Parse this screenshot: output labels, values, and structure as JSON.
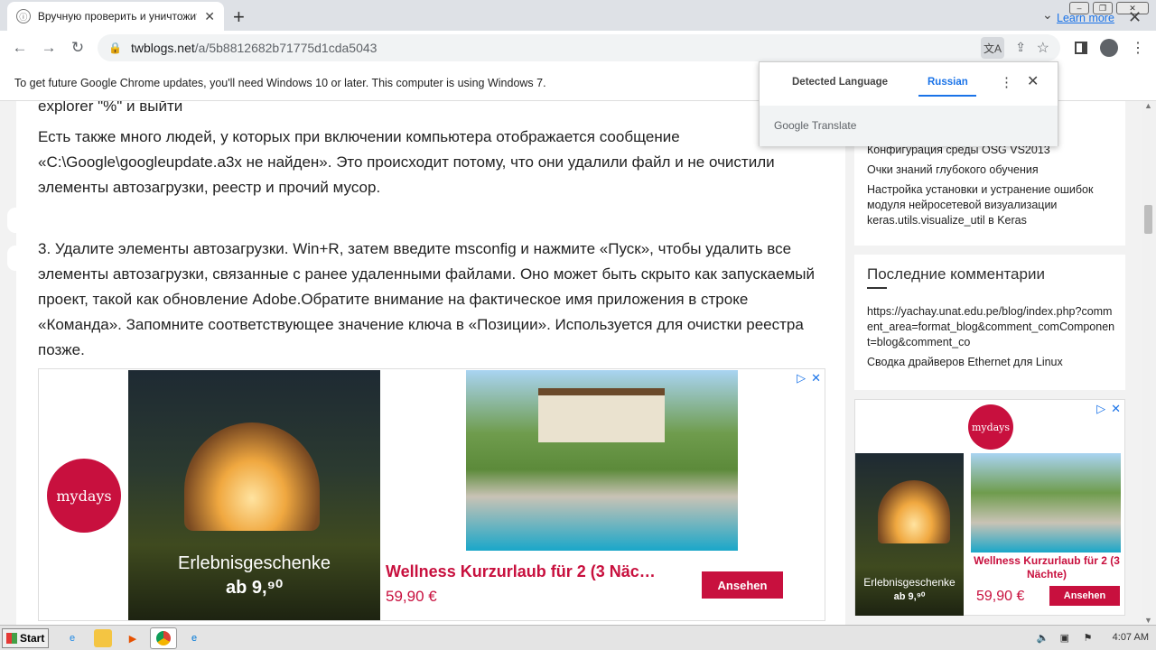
{
  "browser": {
    "tab_title": "Вручную проверить и уничтожить",
    "new_tab_label": "+",
    "url_host": "twblogs.net",
    "url_path": "/a/5b8812682b71775d1cda5043"
  },
  "infobar": {
    "message": "To get future Google Chrome updates, you'll need Windows 10 or later. This computer is using Windows 7.",
    "learn_more": "Learn more"
  },
  "translate_popup": {
    "tab_detected": "Detected Language",
    "tab_target": "Russian",
    "brand": "Google Translate"
  },
  "article": {
    "p_top": "explorer \"%\" и выйти",
    "p1": "Есть также много людей, у которых при включении компьютера отображается сообщение «C:\\Google\\googleupdate.a3x не найден». Это происходит потому, что они удалили файл и не очистили элементы автозагрузки, реестр и прочий мусор.",
    "p2": "3. Удалите элементы автозагрузки. Win+R, затем введите msconfig и нажмите «Пуск», чтобы удалить все элементы автозагрузки, связанные с ранее удаленными файлами. Оно может быть скрыто как запускаемый проект, такой как обновление Adobe.Обратите внимание на фактическое имя приложения в строке «Команда». Запомните соответствующее значение ключа в «Позиции». Используется для очистки реестра позже."
  },
  "ad_main": {
    "logo": "mydays",
    "dome_text1": "Erlebnisgeschenke",
    "dome_text2": "ab 9,⁹⁰",
    "headline": "Wellness Kurzurlaub für 2 (3 Näc…",
    "price": "59,90 €",
    "cta": "Ansehen"
  },
  "sidebar": {
    "links": [
      "Конфигурация среды OSG VS2013",
      "Очки знаний глубокого обучения",
      "Настройка установки и устранение ошибок модуля нейросетевой визуализации keras.utils.visualize_util в Keras"
    ],
    "comments_title": "Последние комментарии",
    "comments": [
      "https://yachay.unat.edu.pe/blog/index.php?comment_area=format_blog&comment_comComponent=blog&comment_co",
      "Сводка драйверов Ethernet для Linux"
    ]
  },
  "ad_side": {
    "logo": "mydays",
    "dome_text1": "Erlebnisgeschenke",
    "dome_text2": "ab 9,⁹⁰",
    "headline": "Wellness Kurzurlaub für 2 (3 Nächte)",
    "price": "59,90 €",
    "cta": "Ansehen"
  },
  "taskbar": {
    "start_label": "Start",
    "clock": "4:07 AM"
  },
  "colors": {
    "accent": "#c8103e",
    "link": "#1a73e8"
  }
}
